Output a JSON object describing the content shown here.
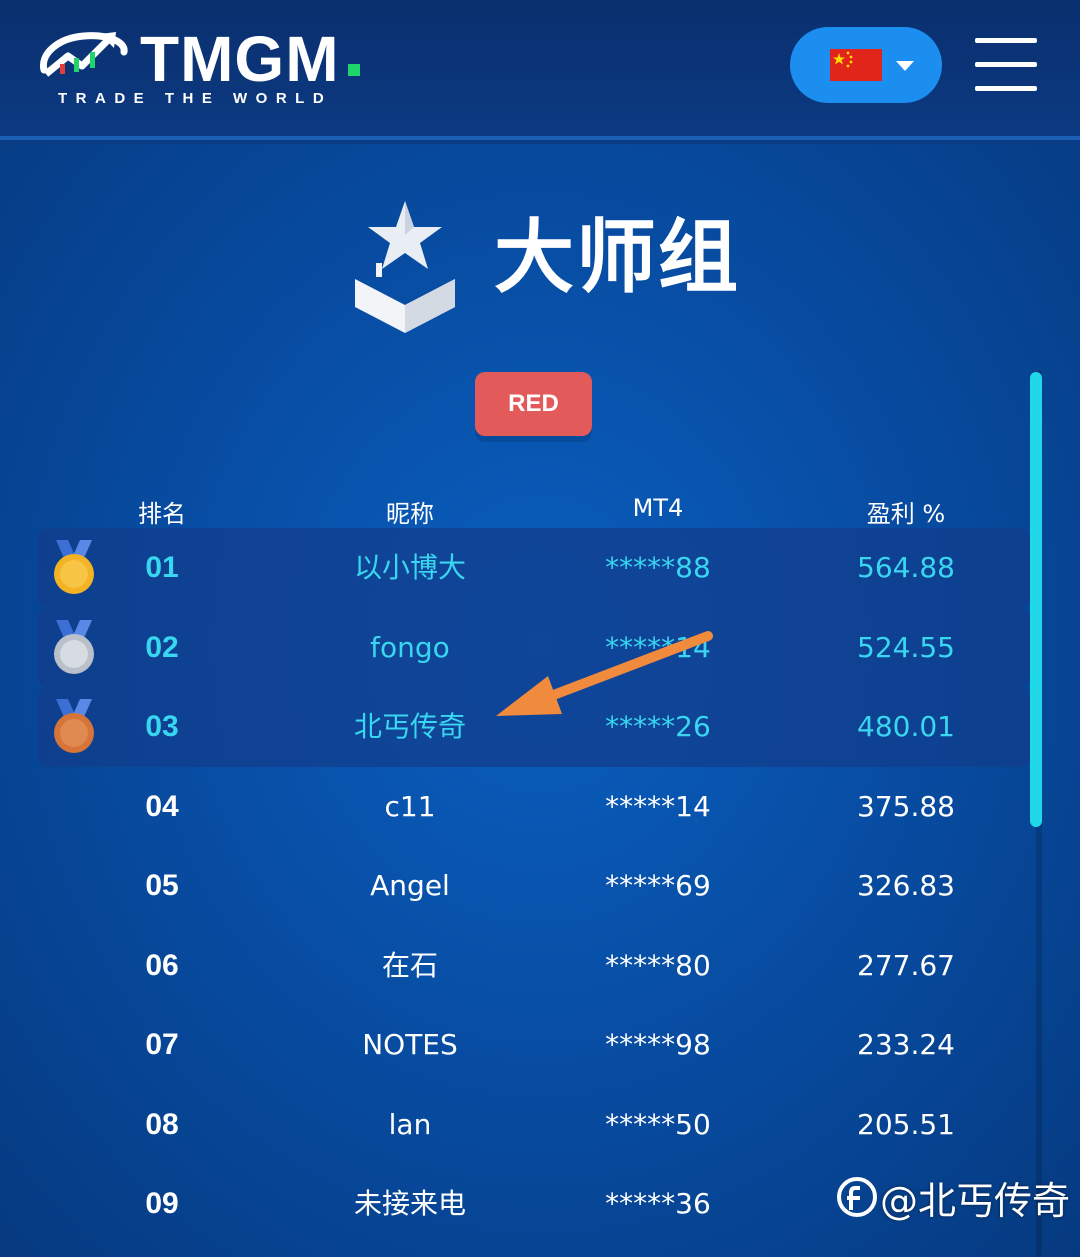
{
  "header": {
    "logo_text": "TMGM",
    "logo_tagline": "TRADE THE WORLD",
    "language": "china-flag-icon",
    "menu_icon": "hamburger-menu-icon"
  },
  "group": {
    "title": "大师组",
    "emblem_icon": "star-rank-emblem-icon",
    "filter_label": "RED"
  },
  "table": {
    "headers": [
      "排名",
      "昵称",
      "MT4",
      "盈利 %"
    ],
    "rows": [
      {
        "rank": "01",
        "name": "以小博大",
        "mt4": "*****88",
        "profit": "564.88",
        "medal": "gold-medal-icon"
      },
      {
        "rank": "02",
        "name": "fongo",
        "mt4": "*****14",
        "profit": "524.55",
        "medal": "silver-medal-icon"
      },
      {
        "rank": "03",
        "name": "北丐传奇",
        "mt4": "*****26",
        "profit": "480.01",
        "medal": "bronze-medal-icon"
      },
      {
        "rank": "04",
        "name": "c11",
        "mt4": "*****14",
        "profit": "375.88"
      },
      {
        "rank": "05",
        "name": "Angel",
        "mt4": "*****69",
        "profit": "326.83"
      },
      {
        "rank": "06",
        "name": "在石",
        "mt4": "*****80",
        "profit": "277.67"
      },
      {
        "rank": "07",
        "name": "NOTES",
        "mt4": "*****98",
        "profit": "233.24"
      },
      {
        "rank": "08",
        "name": "lan",
        "mt4": "*****50",
        "profit": "205.51"
      },
      {
        "rank": "09",
        "name": "未接来电",
        "mt4": "*****36",
        "profit": ""
      }
    ]
  },
  "watermark": {
    "text": "@北丐传奇"
  },
  "colors": {
    "accent": "#38d6f0",
    "button_blue": "#1b8ef0",
    "red_tag": "#e35a5a",
    "arrow": "#f08a3c"
  }
}
